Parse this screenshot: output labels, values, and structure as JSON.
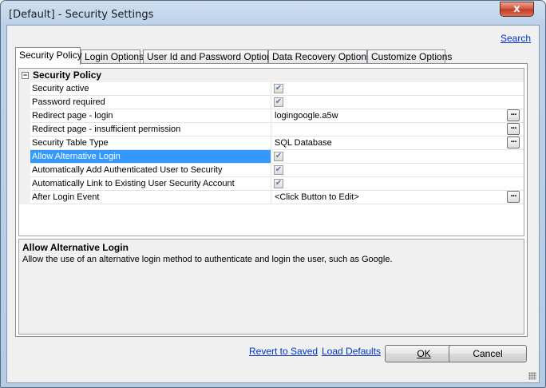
{
  "window": {
    "title": "[Default] - Security Settings",
    "close_label": "x"
  },
  "header": {
    "search_link": "Search"
  },
  "tabs": [
    {
      "label": "Security Policy",
      "active": true
    },
    {
      "label": "Login Options",
      "active": false
    },
    {
      "label": "User Id and Password Options",
      "active": false
    },
    {
      "label": "Data Recovery Options",
      "active": false
    },
    {
      "label": "Customize Options",
      "active": false
    }
  ],
  "grid": {
    "section_title": "Security Policy",
    "expander_glyph": "−",
    "rows": [
      {
        "name": "Security active",
        "value_type": "checkbox",
        "checked": true,
        "value": ""
      },
      {
        "name": "Password required",
        "value_type": "checkbox",
        "checked": true,
        "value": ""
      },
      {
        "name": "Redirect page - login",
        "value_type": "text",
        "value": "logingoogle.a5w",
        "button": true
      },
      {
        "name": "Redirect page - insufficient permission",
        "value_type": "text",
        "value": "",
        "button": true
      },
      {
        "name": "Security Table Type",
        "value_type": "text",
        "value": "SQL Database",
        "button": true
      },
      {
        "name": "Allow Alternative Login",
        "value_type": "checkbox",
        "checked": true,
        "value": "",
        "selected": true
      },
      {
        "name": "Automatically Add Authenticated User to Security",
        "value_type": "checkbox",
        "checked": true,
        "value": ""
      },
      {
        "name": "Automatically Link to Existing User Security Account",
        "value_type": "checkbox",
        "checked": true,
        "value": ""
      },
      {
        "name": "After Login Event",
        "value_type": "text",
        "value": "<Click Button to Edit>",
        "button": true
      }
    ],
    "button_label": "..."
  },
  "description": {
    "title": "Allow Alternative Login",
    "text": "Allow the use of an alternative login method to authenticate and login the user, such as Google."
  },
  "footer": {
    "revert_link": "Revert to Saved",
    "load_defaults_link": "Load Defaults",
    "ok_label": "OK",
    "cancel_label": "Cancel"
  },
  "colors": {
    "selection": "#3399ff",
    "link": "#0033cc",
    "close_button": "#c23a22"
  }
}
